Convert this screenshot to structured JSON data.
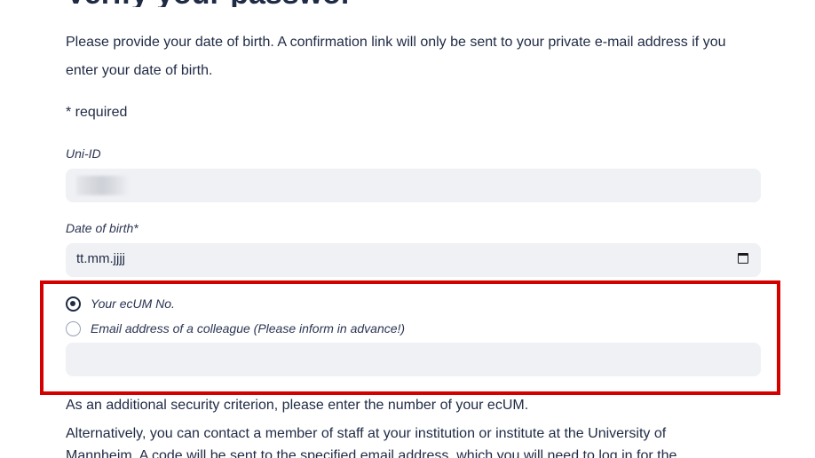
{
  "heading_fragment": "Verify your passwor",
  "intro_text": "Please provide your date of birth. A confirmation link will only be sent to your private e-mail address if you enter your date of birth.",
  "required_note": "* required",
  "uni_id": {
    "label": "Uni-ID"
  },
  "date_of_birth": {
    "label": "Date of birth*",
    "value": "tt.mm.jjjj",
    "icon": "calendar-icon"
  },
  "verification_option": {
    "options": [
      {
        "label": "Your ecUM No.",
        "selected": true
      },
      {
        "label": "Email address of a colleague (Please inform in advance!)",
        "selected": false
      }
    ],
    "input_value": ""
  },
  "highlight_color": "#d40000",
  "footer": {
    "line1": "As an additional security criterion, please enter the number of your ecUM.",
    "line2": "Alternatively, you can contact a member of staff at your institution or institute at the University of",
    "line3_partial": "Mannheim. A code will be sent to the specified email address, which you will need to log in for the"
  }
}
